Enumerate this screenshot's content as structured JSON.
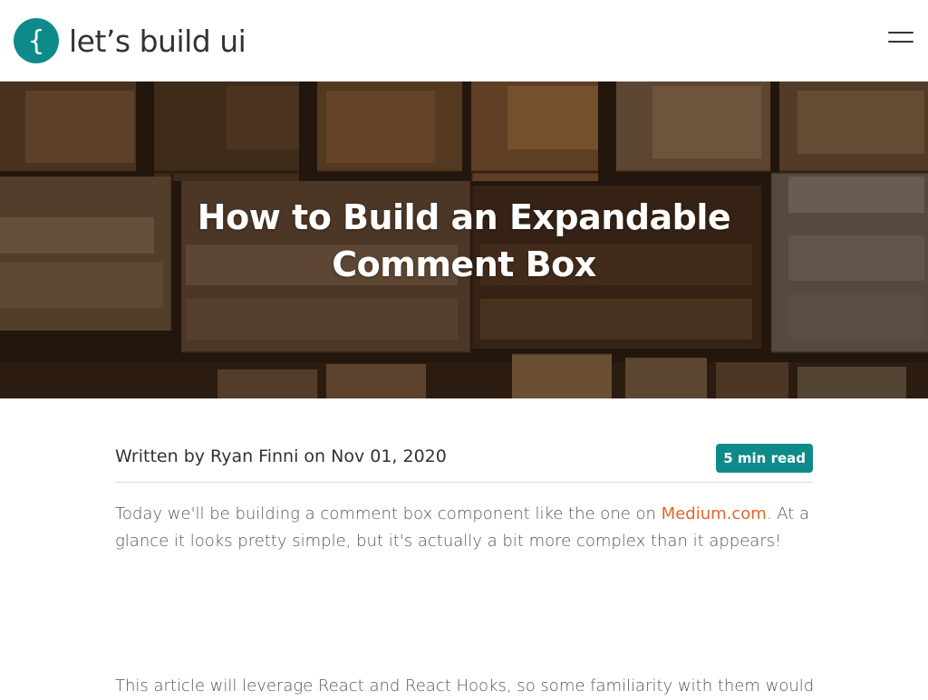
{
  "brand": {
    "name": "let’s build ui",
    "logo_glyph": "{",
    "logo_color": "#0e8a8a"
  },
  "header": {
    "menu_icon": "hamburger-menu-icon"
  },
  "hero": {
    "title": "How to Build an Expandable Comment Box"
  },
  "meta": {
    "byline": "Written by Ryan Finni on Nov 01, 2020",
    "read_time": "5 min read"
  },
  "article": {
    "p1_before": "Today we'll be building a comment box component like the one on ",
    "p1_link": "Medium.com",
    "p1_after": ". At a glance it looks pretty simple, but it's actually a bit more complex than it appears!",
    "p2": "This article will leverage React and React Hooks, so some familiarity with them would"
  },
  "colors": {
    "accent": "#0e8a8a",
    "link": "#e0662a"
  }
}
